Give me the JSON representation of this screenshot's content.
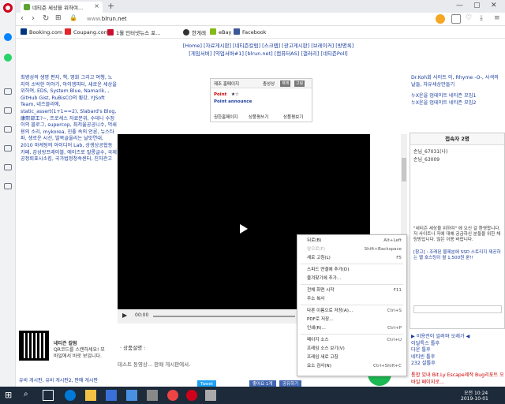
{
  "browser": {
    "tab_title": "네티즌 세상을 위하여...",
    "url_prefix": "www.",
    "url_host": "blrun.net",
    "bookmarks": [
      "Booking.com",
      "Coupang.com",
      "1월 인터넷뉴스 포...",
      "한게레",
      "eBay",
      "Facebook"
    ]
  },
  "page": {
    "topnav_line1": "[Home] [자료게시판] [네티즌칼럼] [스크랩] [광고게시판] [브레이커] [방명록]",
    "topnav_line2": "[게임서버] [약업서버#1] [blrun.net] [컴퓨터AS] [갤러리] [네티즌Poll]",
    "left_text": "최병성의 생명 편지, 책, 영화 그리고 여행, 노지의 소박한 이야기, 아이엠피터, 새로운 세상을 위하여, EDS, System Blue, Namarik, , GitHub Gist, RuBisCO의 횡강, YJSoft Team, 네즈블리에, static_assert(1+1==2), Slabard's Blog, 康熙部王?~, 프로세스 자료분위, 수데니 수정이의 블로그, supercop, 최저율공공니수, 먹새용의 소리, mykorea, 진좋 속의 언론, 뉴스타파, 생로운 시선, 발목골울리는 날맛연대, 2010 마케팅의 아이디어 Lab, 상생상공협동 카페, 감성방프레이블, 에이즈로 말롱글수, 국제공정뢰표시소킴, 국가법정청속센터, 진자관고",
    "right_text_1": "Dr.Koh회 사이트 이, Rhyme -O-, 사색의 날들, 자유세상만들기",
    "right_link_1": "누X운을 업데이트 네티즌 모임1",
    "right_link_2": "누X운을 업데이트 네티즌 모임2",
    "product": {
      "header": "제조 홈페이지",
      "country_label": "충성상",
      "btn1": "재래",
      "btn2": "고링",
      "point_label": "Point",
      "point_value": "★☆",
      "announce_label": "Point announce",
      "footer_left": "권한홈페이지",
      "footer_mid": "상품평쓰기",
      "footer_right": "상품평보기"
    },
    "video": {
      "time": "00:00"
    },
    "desc_title": "· 상품설명 :",
    "desc_body": "테스트 동영상... 판매 게시판에서.",
    "qr_title": "네티즌 칼럼",
    "qr_text": "QR코드를 스캔하세요! 모바일에서 바로 보입니다.",
    "footer_links": "유비 게시판, 유비 게시판2, 판매 게시판",
    "tweet_label": "Tweet",
    "like_label": "좋아요 1개",
    "share_label": "공유하기",
    "right_bottom_1": "▶ 이용전이 알려와 오래가 ◀",
    "right_bottom_2": "이달특스 틀후",
    "right_bottom_3": "다운 틀후",
    "right_bottom_4": "네티빈 틀후",
    "right_bottom_5": "232 설틀후",
    "right_bottom_6": "통합 있내 Bit.Ly Escape제작 Bug리포트 오바일 페이지로..."
  },
  "chat": {
    "title": "접속자 2명",
    "users": [
      "손님_67031(나)",
      "손님_63009"
    ],
    "message": "\"네티즌 세상을 위하여\" 에 오신 걸 환영합니다. 저 사이트나 저에 대해 궁금하신 분들을 위한 채팅방입니다. 많은 이용 바랍니다.",
    "notice": "[참고] : 조래된 물제분에 SSD 스토리지 제공하는 웹 호스팅이 월 1,500원 뿐!!"
  },
  "context_menu": [
    {
      "label": "뒤로(B)",
      "shortcut": "Alt+Left",
      "disabled": false
    },
    {
      "label": "앞으로(F)",
      "shortcut": "Shift+Backspace",
      "disabled": true
    },
    {
      "label": "새로 고침(L)",
      "shortcut": "F5",
      "disabled": false
    },
    {
      "label": "스피드 연결에 추가(D)",
      "shortcut": "",
      "disabled": false
    },
    {
      "label": "즐겨찾기에 추가...",
      "shortcut": "",
      "disabled": false
    },
    {
      "label": "전체 화면 시작",
      "shortcut": "F11",
      "disabled": false
    },
    {
      "label": "주소 복사",
      "shortcut": "",
      "disabled": false
    },
    {
      "label": "다른 이름으로 저장(A)...",
      "shortcut": "Ctrl+S",
      "disabled": false
    },
    {
      "label": "PDF로 저장...",
      "shortcut": "",
      "disabled": false
    },
    {
      "label": "인쇄(R)...",
      "shortcut": "Ctrl+P",
      "disabled": false
    },
    {
      "label": "페이지 소스",
      "shortcut": "Ctrl+U",
      "disabled": false
    },
    {
      "label": "프레임 소스 보기(V)",
      "shortcut": "",
      "disabled": false
    },
    {
      "label": "프레임 새로 고침",
      "shortcut": "",
      "disabled": false
    },
    {
      "label": "요소 검사(N)",
      "shortcut": "Ctrl+Shift+C",
      "disabled": false
    }
  ],
  "taskbar": {
    "time": "오전 10:24",
    "date": "2019-10-01"
  },
  "colors": {
    "opera_red": "#d0021b",
    "link_blue": "#1a3d9e",
    "taskbar": "#1c2a3a"
  }
}
